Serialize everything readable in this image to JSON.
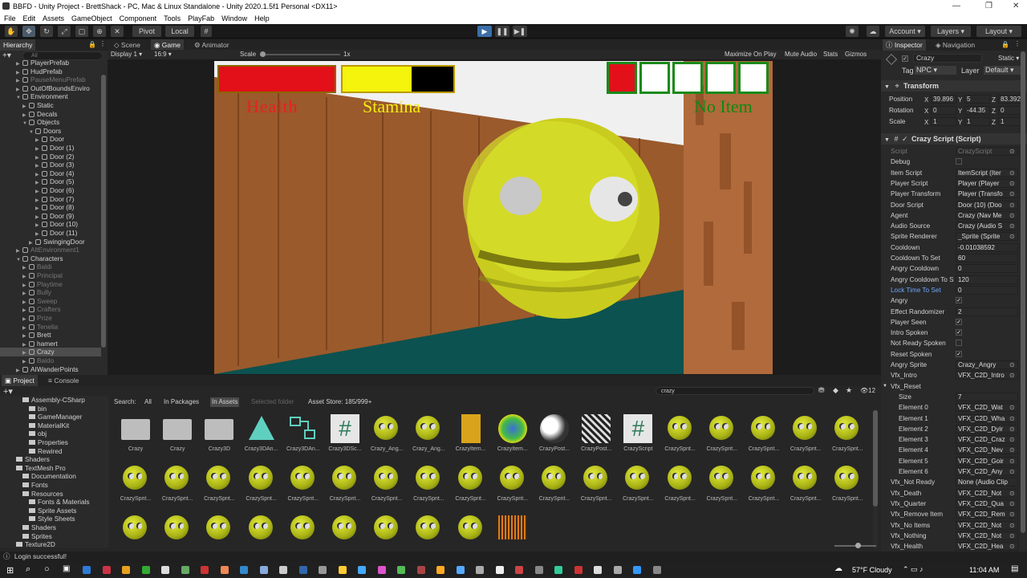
{
  "window": {
    "title": "BBFD - Unity Project - BrettShack - PC, Mac & Linux Standalone - Unity 2020.1.5f1 Personal <DX11>"
  },
  "menu": [
    "File",
    "Edit",
    "Assets",
    "GameObject",
    "Component",
    "Tools",
    "PlayFab",
    "Window",
    "Help"
  ],
  "toolbar": {
    "pivot": "Pivot",
    "local": "Local",
    "account": "Account",
    "layers": "Layers",
    "layout": "Layout"
  },
  "hierarchy": {
    "tab": "Hierarchy",
    "search_placeholder": "All",
    "items": [
      {
        "label": "PlayerPrefab",
        "indent": 2,
        "dim": false,
        "arrow": "▶"
      },
      {
        "label": "HudPrefab",
        "indent": 2,
        "dim": false,
        "arrow": "▶"
      },
      {
        "label": "PauseMenuPrefab",
        "indent": 2,
        "dim": true,
        "arrow": "▶"
      },
      {
        "label": "OutOfBoundsEnviro",
        "indent": 2,
        "dim": false,
        "arrow": "▶"
      },
      {
        "label": "Environment",
        "indent": 2,
        "dim": false,
        "arrow": "▼"
      },
      {
        "label": "Static",
        "indent": 3,
        "dim": false,
        "arrow": "▶"
      },
      {
        "label": "Decals",
        "indent": 3,
        "dim": false,
        "arrow": "▶"
      },
      {
        "label": "Objects",
        "indent": 3,
        "dim": false,
        "arrow": "▼"
      },
      {
        "label": "Doors",
        "indent": 4,
        "dim": false,
        "arrow": "▼"
      },
      {
        "label": "Door",
        "indent": 5,
        "dim": false,
        "arrow": "▶"
      },
      {
        "label": "Door (1)",
        "indent": 5,
        "dim": false,
        "arrow": "▶"
      },
      {
        "label": "Door (2)",
        "indent": 5,
        "dim": false,
        "arrow": "▶"
      },
      {
        "label": "Door (3)",
        "indent": 5,
        "dim": false,
        "arrow": "▶"
      },
      {
        "label": "Door (4)",
        "indent": 5,
        "dim": false,
        "arrow": "▶"
      },
      {
        "label": "Door (5)",
        "indent": 5,
        "dim": false,
        "arrow": "▶"
      },
      {
        "label": "Door (6)",
        "indent": 5,
        "dim": false,
        "arrow": "▶"
      },
      {
        "label": "Door (7)",
        "indent": 5,
        "dim": false,
        "arrow": "▶"
      },
      {
        "label": "Door (8)",
        "indent": 5,
        "dim": false,
        "arrow": "▶"
      },
      {
        "label": "Door (9)",
        "indent": 5,
        "dim": false,
        "arrow": "▶"
      },
      {
        "label": "Door (10)",
        "indent": 5,
        "dim": false,
        "arrow": "▶"
      },
      {
        "label": "Door (11)",
        "indent": 5,
        "dim": false,
        "arrow": "▶"
      },
      {
        "label": "SwingingDoor",
        "indent": 4,
        "dim": false,
        "arrow": "▶"
      },
      {
        "label": "AltEnvironment1",
        "indent": 2,
        "dim": true,
        "arrow": "▶"
      },
      {
        "label": "Characters",
        "indent": 2,
        "dim": false,
        "arrow": "▼"
      },
      {
        "label": "Baldi",
        "indent": 3,
        "dim": true,
        "arrow": "▶"
      },
      {
        "label": "Principal",
        "indent": 3,
        "dim": true,
        "arrow": "▶"
      },
      {
        "label": "Playtime",
        "indent": 3,
        "dim": true,
        "arrow": "▶"
      },
      {
        "label": "Bully",
        "indent": 3,
        "dim": true,
        "arrow": "▶"
      },
      {
        "label": "Sweep",
        "indent": 3,
        "dim": true,
        "arrow": "▶"
      },
      {
        "label": "Crafters",
        "indent": 3,
        "dim": true,
        "arrow": "▶"
      },
      {
        "label": "Prize",
        "indent": 3,
        "dim": true,
        "arrow": "▶"
      },
      {
        "label": "Tenelia",
        "indent": 3,
        "dim": true,
        "arrow": "▶"
      },
      {
        "label": "Brett",
        "indent": 3,
        "dim": false,
        "arrow": "▶"
      },
      {
        "label": "hamert",
        "indent": 3,
        "dim": false,
        "arrow": "▶"
      },
      {
        "label": "Crazy",
        "indent": 3,
        "dim": false,
        "arrow": "▶",
        "selected": true
      },
      {
        "label": "Baldo",
        "indent": 3,
        "dim": true,
        "arrow": "▶"
      },
      {
        "label": "AIWanderPoints",
        "indent": 2,
        "dim": false,
        "arrow": "▶"
      }
    ]
  },
  "game_view": {
    "tabs": [
      "Scene",
      "Game",
      "Animator"
    ],
    "display": "Display 1",
    "aspect": "16:9",
    "scale_label": "Scale",
    "scale_value": "1x",
    "options": [
      "Maximize On Play",
      "Mute Audio",
      "Stats",
      "Gizmos"
    ],
    "hud": {
      "health_label": "Health",
      "stamina_label": "Stamina",
      "item_label": "No Item",
      "health_fill": 1.0,
      "stamina_fill": 0.62
    }
  },
  "inspector": {
    "tabs": [
      "Inspector",
      "Navigation"
    ],
    "object_name": "Crazy",
    "static_label": "Static",
    "tag_label": "Tag",
    "tag_value": "NPC",
    "layer_label": "Layer",
    "layer_value": "Default",
    "transform": {
      "title": "Transform",
      "rows": [
        {
          "label": "Position",
          "x": "39.896",
          "y": "5",
          "z": "83.392"
        },
        {
          "label": "Rotation",
          "x": "0",
          "y": "-44.35",
          "z": "0"
        },
        {
          "label": "Scale",
          "x": "1",
          "y": "1",
          "z": "1"
        }
      ]
    },
    "script_component": {
      "title": "Crazy Script (Script)",
      "rows": [
        {
          "label": "Script",
          "value": "CrazyScript",
          "type": "dim"
        },
        {
          "label": "Debug",
          "value": "",
          "type": "check",
          "checked": false
        },
        {
          "label": "Item Script",
          "value": "ItemScript (Iter",
          "type": "ref"
        },
        {
          "label": "Player Script",
          "value": "Player (Player",
          "type": "ref"
        },
        {
          "label": "Player Transform",
          "value": "Player (Transfo",
          "type": "ref"
        },
        {
          "label": "Door Script",
          "value": "Door (10) (Doo",
          "type": "ref"
        },
        {
          "label": "Agent",
          "value": "Crazy (Nav Me",
          "type": "ref"
        },
        {
          "label": "Audio Source",
          "value": "Crazy (Audio S",
          "type": "ref"
        },
        {
          "label": "Sprite Renderer",
          "value": "_Sprite (Sprite",
          "type": "ref"
        },
        {
          "label": "Cooldown",
          "value": "-0.01038592",
          "type": "text"
        },
        {
          "label": "Cooldown To Set",
          "value": "60",
          "type": "text"
        },
        {
          "label": "Angry Cooldown",
          "value": "0",
          "type": "text"
        },
        {
          "label": "Angry Cooldown To S",
          "value": "120",
          "type": "text"
        },
        {
          "label": "Lock Time To Set",
          "value": "0",
          "type": "text",
          "blue": true
        },
        {
          "label": "Angry",
          "value": "",
          "type": "check",
          "checked": true
        },
        {
          "label": "Effect Randomizer",
          "value": "2",
          "type": "text"
        },
        {
          "label": "Player Seen",
          "value": "",
          "type": "check",
          "checked": true
        },
        {
          "label": "Intro Spoken",
          "value": "",
          "type": "check",
          "checked": true
        },
        {
          "label": "Not Ready Spoken",
          "value": "",
          "type": "check",
          "checked": false
        },
        {
          "label": "Reset Spoken",
          "value": "",
          "type": "check",
          "checked": true
        },
        {
          "label": "Angry Sprite",
          "value": "Crazy_Angry",
          "type": "ref"
        },
        {
          "label": "Vfx_Intro",
          "value": "VFX_C2D_Intro",
          "type": "ref"
        },
        {
          "label": "Vfx_Reset",
          "value": "",
          "type": "header"
        },
        {
          "label": "Size",
          "value": "7",
          "type": "text",
          "indent": true
        },
        {
          "label": "Element 0",
          "value": "VFX_C2D_Wat",
          "type": "ref",
          "indent": true
        },
        {
          "label": "Element 1",
          "value": "VFX_C2D_Wha",
          "type": "ref",
          "indent": true
        },
        {
          "label": "Element 2",
          "value": "VFX_C2D_Dyir",
          "type": "ref",
          "indent": true
        },
        {
          "label": "Element 3",
          "value": "VFX_C2D_Craz",
          "type": "ref",
          "indent": true
        },
        {
          "label": "Element 4",
          "value": "VFX_C2D_Nev",
          "type": "ref",
          "indent": true
        },
        {
          "label": "Element 5",
          "value": "VFX_C2D_Goir",
          "type": "ref",
          "indent": true
        },
        {
          "label": "Element 6",
          "value": "VFX_C2D_Any",
          "type": "ref",
          "indent": true
        },
        {
          "label": "Vfx_Not Ready",
          "value": "None (Audio Clip",
          "type": "text"
        },
        {
          "label": "Vfx_Death",
          "value": "VFX_C2D_Not",
          "type": "ref"
        },
        {
          "label": "Vfx_Quarter",
          "value": "VFX_C2D_Qua",
          "type": "ref"
        },
        {
          "label": "Vfx_Remove Item",
          "value": "VFX_C2D_Rem",
          "type": "ref"
        },
        {
          "label": "Vfx_No Items",
          "value": "VFX_C2D_Not",
          "type": "ref"
        },
        {
          "label": "Vfx_Nothing",
          "value": "VFX_C2D_Not",
          "type": "ref"
        },
        {
          "label": "Vfx_Health",
          "value": "VFX_C2D_Hea",
          "type": "ref"
        }
      ]
    }
  },
  "project": {
    "tabs": [
      "Project",
      "Console"
    ],
    "search_value": "crazy",
    "search_label": "Search:",
    "filters": [
      "All",
      "In Packages",
      "In Assets",
      "Selected folder",
      "Asset Store: 185/999+"
    ],
    "count": "12",
    "folders": [
      {
        "label": "Assembly-CSharp",
        "indent": 1
      },
      {
        "label": "bin",
        "indent": 2
      },
      {
        "label": "GameManager",
        "indent": 2
      },
      {
        "label": "MaterialKit",
        "indent": 2
      },
      {
        "label": "obj",
        "indent": 2
      },
      {
        "label": "Properties",
        "indent": 2
      },
      {
        "label": "Rewired",
        "indent": 2
      },
      {
        "label": "Shaders",
        "indent": 0
      },
      {
        "label": "TextMesh Pro",
        "indent": 0
      },
      {
        "label": "Documentation",
        "indent": 1
      },
      {
        "label": "Fonts",
        "indent": 1
      },
      {
        "label": "Resources",
        "indent": 1
      },
      {
        "label": "Fonts & Materials",
        "indent": 2
      },
      {
        "label": "Sprite Assets",
        "indent": 2
      },
      {
        "label": "Style Sheets",
        "indent": 2
      },
      {
        "label": "Shaders",
        "indent": 1
      },
      {
        "label": "Sprites",
        "indent": 1
      },
      {
        "label": "Texture2D",
        "indent": 0
      }
    ],
    "assets_row1": [
      {
        "label": "Crazy",
        "kind": "folder"
      },
      {
        "label": "Crazy",
        "kind": "folder"
      },
      {
        "label": "Crazy3D",
        "kind": "folder"
      },
      {
        "label": "Crazy3DAn...",
        "kind": "tri"
      },
      {
        "label": "Crazy3DAn...",
        "kind": "graph"
      },
      {
        "label": "Crazy3DSc...",
        "kind": "script"
      },
      {
        "label": "Crazy_Ang...",
        "kind": "face"
      },
      {
        "label": "Crazy_Ang...",
        "kind": "face"
      },
      {
        "label": "CrazyItem...",
        "kind": "item"
      },
      {
        "label": "CrazyItem...",
        "kind": "ball"
      },
      {
        "label": "CrazyPost...",
        "kind": "post"
      },
      {
        "label": "CrazyPost...",
        "kind": "post2"
      },
      {
        "label": "CrazyScript",
        "kind": "script"
      },
      {
        "label": "CrazySprit...",
        "kind": "face"
      },
      {
        "label": "CrazySprit...",
        "kind": "face"
      },
      {
        "label": "CrazySprit...",
        "kind": "face"
      },
      {
        "label": "CrazySprit...",
        "kind": "face"
      },
      {
        "label": "CrazySprit...",
        "kind": "face"
      }
    ],
    "assets_row2_label": "CrazySprit...",
    "status": "Login successful!"
  },
  "taskbar": {
    "weather": "57°F Cloudy",
    "time": "11:04 AM"
  }
}
